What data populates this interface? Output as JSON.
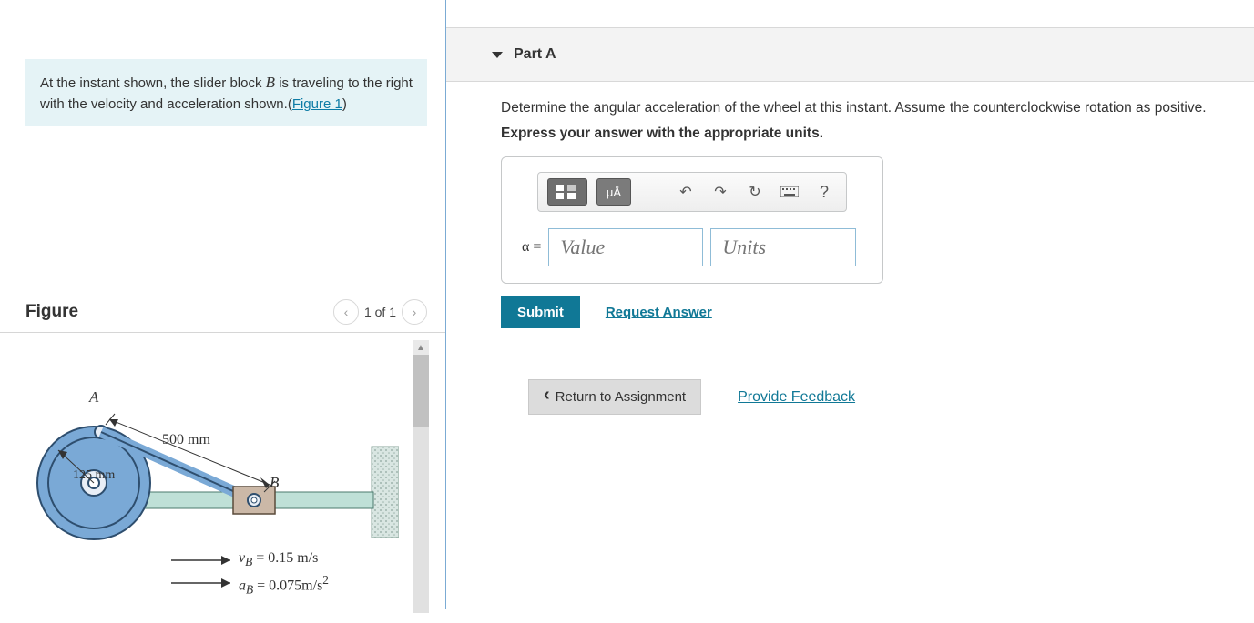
{
  "problem": {
    "text_prefix": "At the instant shown, the slider block ",
    "var": "B",
    "text_suffix": " is traveling to the right with the velocity and acceleration shown.(",
    "figure_link": "Figure 1",
    "text_close": ")"
  },
  "figure": {
    "title": "Figure",
    "nav_label": "1 of 1",
    "dim_rod": "500 mm",
    "dim_radius": "125 mm",
    "label_A": "A",
    "label_B": "B",
    "vB_label": "v_B = 0.15 m/s",
    "aB_label": "a_B = 0.075m/s²",
    "vB_pre": "v",
    "vB_sub": "B",
    "vB_val": " = 0.15 m/s",
    "aB_pre": "a",
    "aB_sub": "B",
    "aB_val": " = 0.075m/s",
    "aB_sup": "2"
  },
  "part": {
    "title": "Part A",
    "prompt1": "Determine the angular acceleration of the wheel at this instant. Assume the counterclockwise rotation as positive.",
    "prompt2": "Express your answer with the appropriate units.",
    "answer_symbol": "α =",
    "value_placeholder": "Value",
    "units_placeholder": "Units",
    "toolbar_units": "μÅ",
    "help": "?",
    "submit": "Submit",
    "request": "Request Answer"
  },
  "nav": {
    "return": "Return to Assignment",
    "feedback": "Provide Feedback"
  }
}
